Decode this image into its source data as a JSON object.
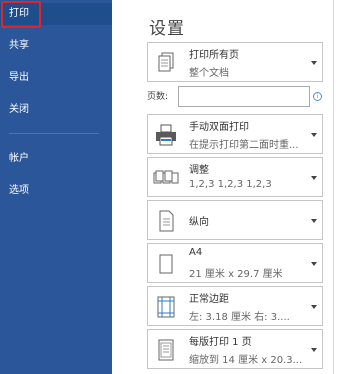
{
  "nav": {
    "items": [
      {
        "label": "打印"
      },
      {
        "label": "共享"
      },
      {
        "label": "导出"
      },
      {
        "label": "关闭"
      },
      {
        "label": "帐户"
      },
      {
        "label": "选项"
      }
    ]
  },
  "settings": {
    "title": "设置",
    "pages_label": "页数:",
    "pages_value": "",
    "info_glyph": "i",
    "options": [
      {
        "title": "打印所有页",
        "subtitle": "整个文档",
        "icon": "document-pages-icon"
      },
      {
        "title": "手动双面打印",
        "subtitle": "在提示打印第二面时重...",
        "icon": "printer-icon"
      },
      {
        "title": "调整",
        "subtitle": "1,2,3    1,2,3    1,2,3",
        "icon": "collate-icon"
      },
      {
        "title": "纵向",
        "icon": "portrait-icon"
      },
      {
        "title": "A4",
        "subtitle": "21 厘米 x 29.7 厘米",
        "icon": "paper-size-icon"
      },
      {
        "title": "正常边距",
        "subtitle": "左: 3.18 厘米    右: 3....",
        "icon": "margins-icon"
      },
      {
        "title": "每版打印 1 页",
        "subtitle": "缩放到 14 厘米 x 20.3...",
        "icon": "pages-per-sheet-icon"
      }
    ]
  },
  "colors": {
    "sidebar": "#2b579a",
    "active_outline": "#e2232a"
  }
}
